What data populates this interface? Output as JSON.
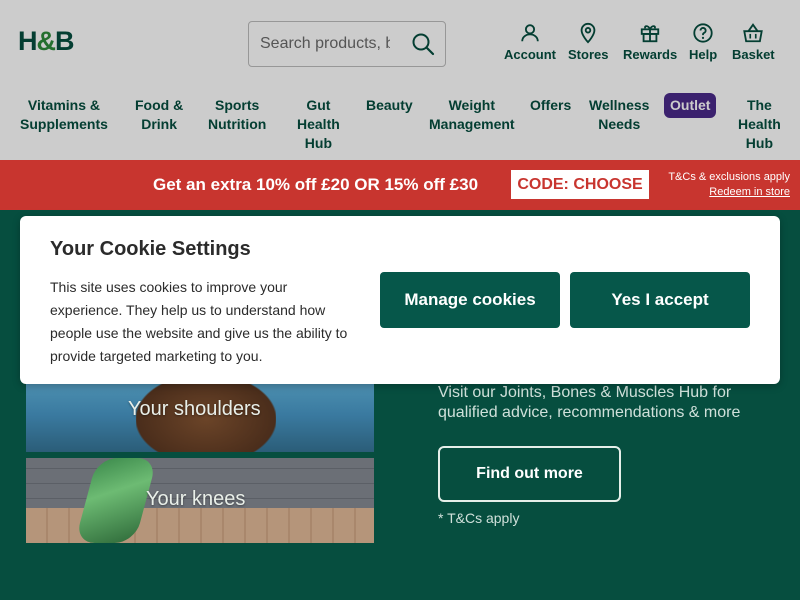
{
  "header": {
    "logo": {
      "h": "H",
      "amp": "&",
      "b": "B"
    },
    "search": {
      "placeholder": "Search products, b"
    },
    "utility": [
      {
        "label": "Account",
        "icon": "person-icon"
      },
      {
        "label": "Stores",
        "icon": "location-pin-icon"
      },
      {
        "label": "Rewards",
        "icon": "gift-icon"
      },
      {
        "label": "Help",
        "icon": "help-circle-icon"
      },
      {
        "label": "Basket",
        "icon": "basket-icon"
      }
    ],
    "nav": [
      {
        "line1": "Vitamins &",
        "line2": "Supplements"
      },
      {
        "line1": "Food &",
        "line2": "Drink"
      },
      {
        "line1": "Sports",
        "line2": "Nutrition"
      },
      {
        "line1": "Gut",
        "line2": "Health",
        "line3": "Hub"
      },
      {
        "line1": "Beauty"
      },
      {
        "line1": "Weight",
        "line2": "Management"
      },
      {
        "line1": "Offers"
      },
      {
        "line1": "Wellness",
        "line2": "Needs"
      },
      {
        "line1": "Outlet"
      },
      {
        "line1": "The",
        "line2": "Health",
        "line3": "Hub"
      }
    ]
  },
  "promo": {
    "text": "Get an extra 10% off £20 OR 15% off £30",
    "code": "CODE: CHOOSE",
    "tc": "T&Cs & exclusions apply",
    "redeem": "Redeem in store"
  },
  "hero": {
    "tile1": "Your shoulders",
    "tile2": "Your knees",
    "description": "Visit our Joints, Bones & Muscles Hub for qualified advice, recommendations & more",
    "button": "Find out more",
    "tc": "* T&Cs apply"
  },
  "cookie": {
    "title": "Your Cookie Settings",
    "body": "This site uses cookies to improve your experience. They help us to understand how people use the website and give us the ability to provide targeted marketing to you.",
    "manage": "Manage cookies",
    "accept": "Yes I accept"
  },
  "colors": {
    "brand_green": "#064e3f",
    "promo_red": "#c8352f",
    "outlet_purple": "#4a2a8a",
    "button_green": "#06574a"
  }
}
